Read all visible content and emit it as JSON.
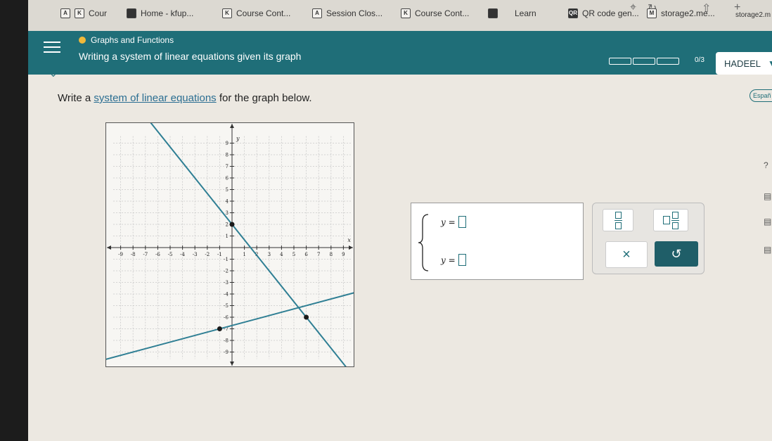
{
  "tabs": [
    {
      "favicon": "K",
      "label": "Cour"
    },
    {
      "favicon": "",
      "label": "Home - kfup..."
    },
    {
      "favicon": "K",
      "label": "Course Cont..."
    },
    {
      "favicon": "A",
      "label": "Session Clos..."
    },
    {
      "favicon": "K",
      "label": "Course Cont..."
    },
    {
      "favicon": "",
      "label": "Learn"
    },
    {
      "favicon": "QR",
      "label": "QR code gen..."
    },
    {
      "favicon": "M",
      "label": "storage2.me..."
    },
    {
      "favicon": "",
      "label": "storage2.m"
    }
  ],
  "first_tab_icon": "A",
  "header": {
    "topic": "Graphs and Functions",
    "lesson": "Writing a system of linear equations given its graph",
    "progress": "0/3",
    "user": "HADEEL"
  },
  "question": {
    "prefix": "Write a ",
    "link": "system of linear equations",
    "suffix": " for the graph below."
  },
  "language_button": "Españ",
  "graph": {
    "x_label": "x",
    "y_label": "y",
    "x_range": [
      -9,
      9
    ],
    "y_range": [
      -9,
      9
    ],
    "lines": [
      {
        "points": [
          [
            0,
            2
          ],
          [
            6,
            -6
          ]
        ]
      },
      {
        "points": [
          [
            -1,
            -7
          ],
          [
            6,
            -5
          ]
        ]
      }
    ],
    "points": [
      [
        0,
        2
      ],
      [
        6,
        -6
      ],
      [
        -1,
        -7
      ]
    ],
    "color": "#2f7f94"
  },
  "answer": {
    "eq1": "y =",
    "eq2": "y ="
  },
  "tools": {
    "clear": "×",
    "undo": "↺"
  },
  "colors": {
    "accent": "#1f6e78",
    "progress_text": "#ffffff"
  }
}
